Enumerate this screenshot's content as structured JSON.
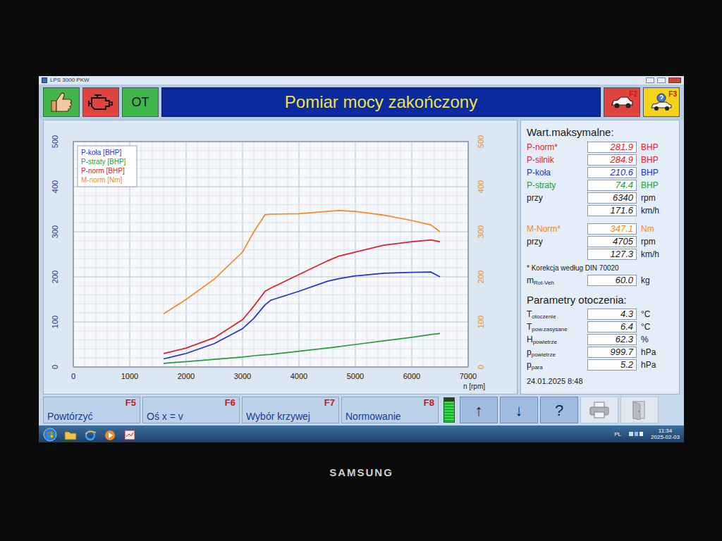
{
  "window": {
    "title": "LPS 3000 PKW"
  },
  "toolbar": {
    "ot_label": "OT",
    "title": "Pomiar mocy zakończony",
    "right_buttons": [
      {
        "key": "F2"
      },
      {
        "key": "F3"
      }
    ]
  },
  "chart": {
    "y_ticks": [
      "0",
      "100",
      "200",
      "300",
      "400",
      "500"
    ],
    "y2_ticks": [
      "0",
      "100",
      "200",
      "300",
      "400",
      "500"
    ],
    "x_ticks": [
      "0",
      "1000",
      "2000",
      "3000",
      "4000",
      "5000",
      "6000",
      "7000"
    ],
    "x_label": "n [rpm]",
    "rpm": [
      1600,
      2000,
      2500,
      3000,
      3200,
      3400,
      3500,
      4000,
      4500,
      4705,
      5000,
      5500,
      6000,
      6340,
      6500
    ],
    "series": [
      {
        "name": "P-koła [BHP]",
        "color": "#2233cc",
        "axis": "left",
        "values": [
          18,
          30,
          52,
          85,
          108,
          138,
          148,
          168,
          190,
          196,
          202,
          208,
          210,
          210.6,
          200
        ]
      },
      {
        "name": "P-straty [BHP]",
        "color": "#2a9a3a",
        "axis": "left",
        "values": [
          8,
          12,
          17,
          22,
          25,
          27,
          28,
          35,
          42,
          45,
          50,
          58,
          66,
          72,
          74.4
        ]
      },
      {
        "name": "P-norm [BHP]",
        "color": "#d8232a",
        "axis": "left",
        "values": [
          30,
          42,
          65,
          105,
          135,
          168,
          175,
          205,
          235,
          246,
          255,
          270,
          278,
          281.9,
          278
        ]
      },
      {
        "name": "M-norm [Nm]",
        "color": "#f08a24",
        "axis": "right",
        "values": [
          118,
          150,
          195,
          255,
          300,
          338,
          339,
          340,
          345,
          347.1,
          345,
          337,
          325,
          315,
          300
        ]
      }
    ]
  },
  "panel": {
    "max_title": "Wart.maksymalne:",
    "max_rows": [
      {
        "label": "P-norm*",
        "value": "281.9",
        "unit": "BHP",
        "color": "#d8232a"
      },
      {
        "label": "P-silnik",
        "value": "284.9",
        "unit": "BHP",
        "color": "#d8232a"
      },
      {
        "label": "P-koła",
        "value": "210.6",
        "unit": "BHP",
        "color": "#2233cc"
      },
      {
        "label": "P-straty",
        "value": "74.4",
        "unit": "BHP",
        "color": "#2a9a3a"
      },
      {
        "label": "przy",
        "value": "6340",
        "unit": "rpm",
        "color": "#1a1a1a"
      },
      {
        "value": "171.6",
        "unit": "km/h",
        "color": "#1a1a1a"
      }
    ],
    "torque_rows": [
      {
        "label": "M-Norm*",
        "value": "347.1",
        "unit": "Nm",
        "color": "#f08a24"
      },
      {
        "label": "przy",
        "value": "4705",
        "unit": "rpm",
        "color": "#1a1a1a"
      },
      {
        "value": "127.3",
        "unit": "km/h",
        "color": "#1a1a1a"
      }
    ],
    "note": "* Korekcja według DIN 70020",
    "mass_row": {
      "label": "m",
      "sub": "Rot-Veh",
      "value": "60.0",
      "unit": "kg",
      "color": "#1a1a1a"
    },
    "ambient_title": "Parametry otoczenia:",
    "ambient_rows": [
      {
        "label": "T",
        "sub": "otoczenie",
        "value": "4.3",
        "unit": "°C",
        "color": "#1a1a1a"
      },
      {
        "label": "T",
        "sub": "pow.zasysane",
        "value": "6.4",
        "unit": "°C",
        "color": "#1a1a1a"
      },
      {
        "label": "H",
        "sub": "powietrze",
        "value": "62.3",
        "unit": "%",
        "color": "#1a1a1a"
      },
      {
        "label": "p",
        "sub": "powietrze",
        "value": "999.7",
        "unit": "hPa",
        "color": "#1a1a1a"
      },
      {
        "label": "p",
        "sub": "para",
        "value": "5.2",
        "unit": "hPa",
        "color": "#1a1a1a"
      }
    ],
    "timestamp": "24.01.2025 8:48"
  },
  "bottom_bar": {
    "keys": [
      {
        "label": "Powtórzyć",
        "key": "F5"
      },
      {
        "label": "Oś x = v",
        "key": "F6"
      },
      {
        "label": "Wybór krzywej",
        "key": "F7"
      },
      {
        "label": "Normowanie",
        "key": "F8"
      }
    ],
    "battery": {
      "level": 0.85
    },
    "nav": [
      {
        "label": "↑"
      },
      {
        "label": "↓"
      },
      {
        "label": "?"
      }
    ],
    "print_button": {
      "disabled": true
    },
    "exit_button": {
      "disabled": true
    }
  },
  "taskbar": {
    "language": "PL",
    "time": "11:34",
    "date": "2025-02-03"
  },
  "monitor": {
    "brand": "SAMSUNG"
  }
}
